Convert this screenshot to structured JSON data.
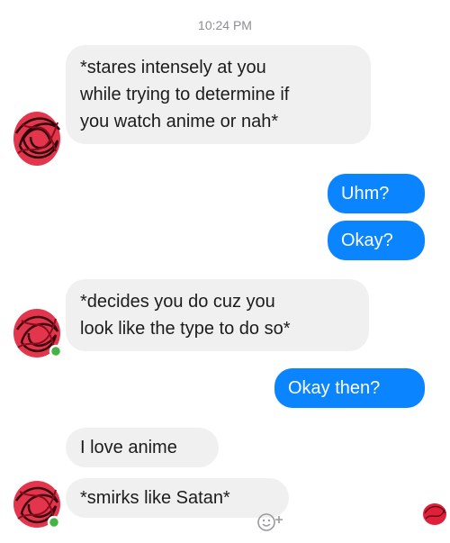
{
  "timestamp": "10:24 PM",
  "messages": {
    "m1": {
      "lines": [
        "*stares intensely at you",
        "while trying to determine if",
        "you watch anime or nah*"
      ]
    },
    "m2": {
      "text": "Uhm?"
    },
    "m3": {
      "text": "Okay?"
    },
    "m4": {
      "lines": [
        "*decides you do cuz you",
        "look like the type to do so*"
      ]
    },
    "m5": {
      "text": "Okay then?"
    },
    "m6": {
      "text": "I love anime"
    },
    "m7": {
      "text": "*smirks like Satan*"
    }
  },
  "icons": {
    "avatar": "avatar-scribbled-red",
    "online_status": "online-dot-icon",
    "reaction": "add-reaction-icon"
  },
  "colors": {
    "outgoing_bubble": "#0a84ff",
    "incoming_bubble": "#f1f0f0",
    "timestamp_text": "#8e8e93",
    "online_dot": "#44b244",
    "avatar_scribble": "#e0203a"
  }
}
